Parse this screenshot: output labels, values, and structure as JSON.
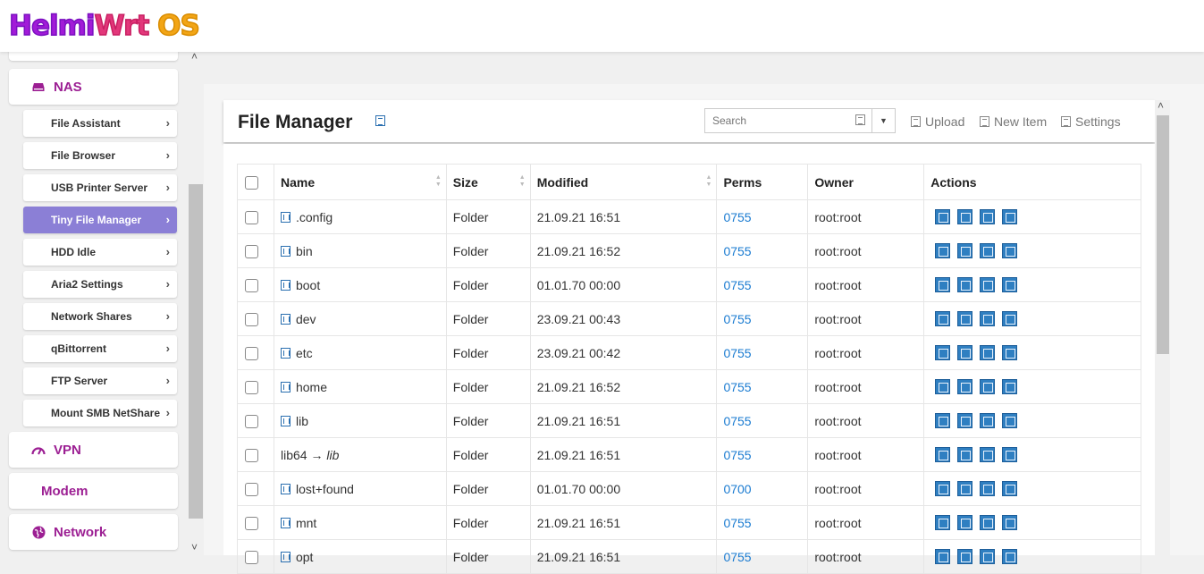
{
  "logo": {
    "part1": "Helmi",
    "part2": "Wrt",
    "part3": " OS"
  },
  "sidebar": {
    "nas": {
      "label": "NAS",
      "icon": "hdd-icon"
    },
    "items": [
      {
        "label": "File Assistant"
      },
      {
        "label": "File Browser"
      },
      {
        "label": "USB Printer Server"
      },
      {
        "label": "Tiny File Manager",
        "active": true
      },
      {
        "label": "HDD Idle"
      },
      {
        "label": "Aria2 Settings"
      },
      {
        "label": "Network Shares"
      },
      {
        "label": "qBittorrent"
      },
      {
        "label": "FTP Server"
      },
      {
        "label": "Mount SMB NetShare"
      }
    ],
    "vpn": {
      "label": "VPN",
      "icon": "gauge-icon"
    },
    "modem": {
      "label": "Modem"
    },
    "network": {
      "label": "Network",
      "icon": "globe-icon"
    }
  },
  "header": {
    "title": "File Manager",
    "search": {
      "placeholder": "Search",
      "value": ""
    },
    "upload": "Upload",
    "new_item": "New Item",
    "settings": "Settings"
  },
  "table": {
    "columns": [
      "Name",
      "Size",
      "Modified",
      "Perms",
      "Owner",
      "Actions"
    ],
    "rows": [
      {
        "name": ".config",
        "size": "Folder",
        "modified": "21.09.21 16:51",
        "perms": "0755",
        "owner": "root:root"
      },
      {
        "name": "bin",
        "size": "Folder",
        "modified": "21.09.21 16:52",
        "perms": "0755",
        "owner": "root:root"
      },
      {
        "name": "boot",
        "size": "Folder",
        "modified": "01.01.70 00:00",
        "perms": "0755",
        "owner": "root:root"
      },
      {
        "name": "dev",
        "size": "Folder",
        "modified": "23.09.21 00:43",
        "perms": "0755",
        "owner": "root:root"
      },
      {
        "name": "etc",
        "size": "Folder",
        "modified": "23.09.21 00:42",
        "perms": "0755",
        "owner": "root:root"
      },
      {
        "name": "home",
        "size": "Folder",
        "modified": "21.09.21 16:52",
        "perms": "0755",
        "owner": "root:root"
      },
      {
        "name": "lib",
        "size": "Folder",
        "modified": "21.09.21 16:51",
        "perms": "0755",
        "owner": "root:root"
      },
      {
        "name": "lib64",
        "link_target": "lib",
        "arrow": "→",
        "size": "Folder",
        "modified": "21.09.21 16:51",
        "perms": "0755",
        "owner": "root:root"
      },
      {
        "name": "lost+found",
        "size": "Folder",
        "modified": "01.01.70 00:00",
        "perms": "0700",
        "owner": "root:root"
      },
      {
        "name": "mnt",
        "size": "Folder",
        "modified": "21.09.21 16:51",
        "perms": "0755",
        "owner": "root:root"
      },
      {
        "name": "opt",
        "size": "Folder",
        "modified": "21.09.21 16:51",
        "perms": "0755",
        "owner": "root:root"
      }
    ],
    "action_icons": [
      "delete-icon",
      "rename-icon",
      "copy-icon",
      "link-icon"
    ]
  },
  "colors": {
    "accent": "#9c1f93",
    "active_item": "#8b7fd6",
    "perm_link": "#1a7bd1",
    "action_btn": "#2f7fc1"
  }
}
